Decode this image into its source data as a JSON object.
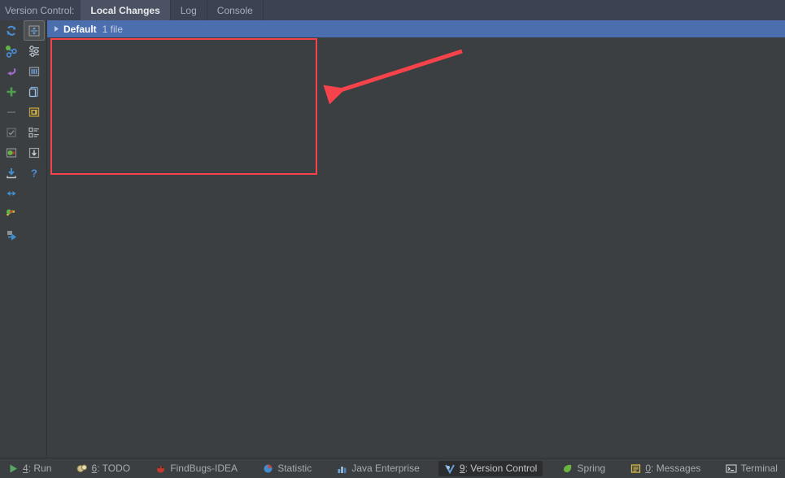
{
  "header": {
    "label": "Version Control:",
    "tabs": [
      {
        "label": "Local Changes",
        "active": true
      },
      {
        "label": "Log",
        "active": false
      },
      {
        "label": "Console",
        "active": false
      }
    ]
  },
  "toolbar": {
    "buttons": [
      {
        "name": "refresh-icon",
        "title": "Refresh"
      },
      {
        "name": "expand-collapse-icon",
        "title": "Collapse All",
        "selected": true
      },
      {
        "name": "commit-changes-icon",
        "title": "Commit Changes"
      },
      {
        "name": "show-diff-icon",
        "title": "Show Diff"
      },
      {
        "name": "revert-icon",
        "title": "Revert"
      },
      {
        "name": "shelve-icon",
        "title": "Shelve Silently"
      },
      {
        "name": "add-icon",
        "title": "New Changelist"
      },
      {
        "name": "move-to-changelist-icon",
        "title": "Move to Another Changelist"
      },
      {
        "name": "delete-icon",
        "title": "Delete"
      },
      {
        "name": "edit-source-icon",
        "title": "Edit Source"
      },
      {
        "name": "set-active-icon",
        "title": "Set Active Changelist"
      },
      {
        "name": "group-by-icon",
        "title": "Group By"
      },
      {
        "name": "rollback-icon",
        "title": "Rollback"
      },
      {
        "name": "configure-icon",
        "title": "Configure"
      },
      {
        "name": "help-icon",
        "title": "Help"
      },
      {
        "name": "update-project-icon",
        "title": "Update Project"
      },
      {
        "name": "collapse-expand-icon",
        "title": "Expand All"
      },
      {
        "name": "changelist-conflict-icon",
        "title": "Resolve Conflicts"
      },
      {
        "name": "push-commits-icon",
        "title": "Push"
      }
    ]
  },
  "changelist": {
    "expander": "collapsed",
    "name": "Default",
    "count": "1 file"
  },
  "annotations": {
    "rectangle_color": "#f5424b",
    "arrow_color": "#f5424b"
  },
  "statusbar": {
    "items": [
      {
        "mnemonic": "4",
        "label": ": Run",
        "icon": "run-icon",
        "active": false
      },
      {
        "mnemonic": "6",
        "label": ": TODO",
        "icon": "todo-icon",
        "active": false
      },
      {
        "mnemonic": "",
        "label": "FindBugs-IDEA",
        "icon": "findbugs-icon",
        "active": false
      },
      {
        "mnemonic": "",
        "label": "Statistic",
        "icon": "statistic-icon",
        "active": false
      },
      {
        "mnemonic": "",
        "label": "Java Enterprise",
        "icon": "java-enterprise-icon",
        "active": false
      },
      {
        "mnemonic": "9",
        "label": ": Version Control",
        "icon": "version-control-icon",
        "active": true
      },
      {
        "mnemonic": "",
        "label": "Spring",
        "icon": "spring-icon",
        "active": false
      },
      {
        "mnemonic": "0",
        "label": ": Messages",
        "icon": "messages-icon",
        "active": false
      },
      {
        "mnemonic": "",
        "label": "Terminal",
        "icon": "terminal-icon",
        "active": false
      }
    ]
  }
}
